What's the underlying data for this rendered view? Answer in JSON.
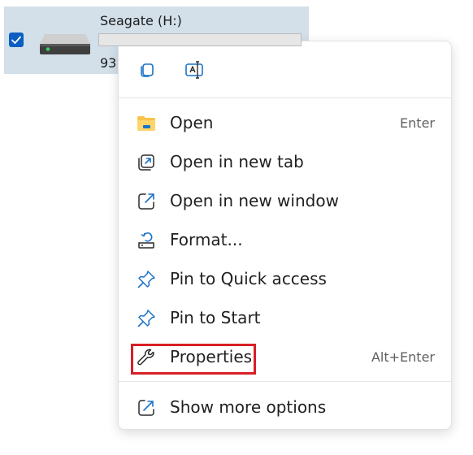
{
  "drive": {
    "name": "Seagate (H:)",
    "size_text": "93",
    "checked": true
  },
  "menu": {
    "toolbar": [
      {
        "name": "copy-icon"
      },
      {
        "name": "rename-icon"
      }
    ],
    "items": [
      {
        "label": "Open",
        "shortcut": "Enter",
        "icon": "folder-icon"
      },
      {
        "label": "Open in new tab",
        "shortcut": "",
        "icon": "new-tab-icon"
      },
      {
        "label": "Open in new window",
        "shortcut": "",
        "icon": "new-window-icon"
      },
      {
        "label": "Format...",
        "shortcut": "",
        "icon": "format-icon"
      },
      {
        "label": "Pin to Quick access",
        "shortcut": "",
        "icon": "pin-icon"
      },
      {
        "label": "Pin to Start",
        "shortcut": "",
        "icon": "pin-icon"
      },
      {
        "label": "Properties",
        "shortcut": "Alt+Enter",
        "icon": "wrench-icon"
      }
    ],
    "more": {
      "label": "Show more options",
      "icon": "show-more-icon"
    }
  },
  "colors": {
    "accent": "#0b5fc2",
    "icon_blue": "#1a73c8",
    "folder_yellow": "#f7c34a",
    "highlight_red": "#d81f26"
  }
}
